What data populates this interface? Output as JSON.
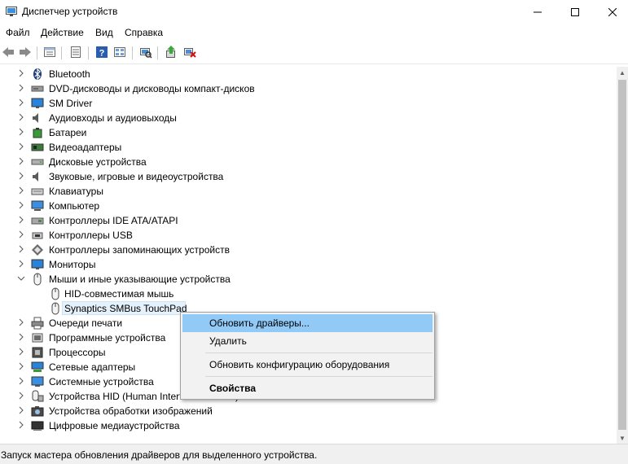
{
  "window": {
    "title": "Диспетчер устройств",
    "minimize": "—",
    "maximize": "☐",
    "close": "✕"
  },
  "menu": [
    "Файл",
    "Действие",
    "Вид",
    "Справка"
  ],
  "toolbar": [
    "back-arrow-icon",
    "forward-arrow-icon",
    "properties-icon",
    "list-view-icon",
    "help-icon",
    "resources-view-icon",
    "scan-hardware-icon",
    "update-driver-icon",
    "uninstall-device-icon"
  ],
  "tree": {
    "categories": [
      {
        "label": "Bluetooth",
        "icon": "bluetooth-icon",
        "expanded": false
      },
      {
        "label": "DVD-дисководы и дисководы компакт-дисков",
        "icon": "dvd-drive-icon",
        "expanded": false
      },
      {
        "label": "SM Driver",
        "icon": "monitor-icon",
        "expanded": false
      },
      {
        "label": "Аудиовходы и аудиовыходы",
        "icon": "speaker-icon",
        "expanded": false
      },
      {
        "label": "Батареи",
        "icon": "battery-icon",
        "expanded": false
      },
      {
        "label": "Видеоадаптеры",
        "icon": "display-adapter-icon",
        "expanded": false
      },
      {
        "label": "Дисковые устройства",
        "icon": "disk-drive-icon",
        "expanded": false
      },
      {
        "label": "Звуковые, игровые и видеоустройства",
        "icon": "speaker-icon",
        "expanded": false
      },
      {
        "label": "Клавиатуры",
        "icon": "keyboard-icon",
        "expanded": false
      },
      {
        "label": "Компьютер",
        "icon": "computer-icon",
        "expanded": false
      },
      {
        "label": "Контроллеры IDE ATA/ATAPI",
        "icon": "ide-controller-icon",
        "expanded": false
      },
      {
        "label": "Контроллеры USB",
        "icon": "usb-icon",
        "expanded": false
      },
      {
        "label": "Контроллеры запоминающих устройств",
        "icon": "storage-controller-icon",
        "expanded": false
      },
      {
        "label": "Мониторы",
        "icon": "monitor-icon",
        "expanded": false
      },
      {
        "label": "Мыши и иные указывающие устройства",
        "icon": "mouse-icon",
        "expanded": true
      }
    ],
    "mouse_children": [
      {
        "label": "HID-совместимая мышь",
        "icon": "mouse-icon"
      },
      {
        "label": "Synaptics SMBus TouchPad",
        "icon": "mouse-icon",
        "selected": true
      }
    ],
    "categories_after": [
      {
        "label": "Очереди печати",
        "icon": "printer-icon"
      },
      {
        "label": "Программные устройства",
        "icon": "software-device-icon"
      },
      {
        "label": "Процессоры",
        "icon": "processor-icon"
      },
      {
        "label": "Сетевые адаптеры",
        "icon": "network-adapter-icon"
      },
      {
        "label": "Системные устройства",
        "icon": "system-device-icon"
      },
      {
        "label": "Устройства HID (Human Interface Devices)",
        "icon": "hid-icon"
      },
      {
        "label": "Устройства обработки изображений",
        "icon": "camera-icon"
      },
      {
        "label": "Цифровые медиаустройства",
        "icon": "media-device-icon"
      }
    ]
  },
  "context_menu": {
    "update_drivers": "Обновить драйверы...",
    "uninstall": "Удалить",
    "scan_hardware": "Обновить конфигурацию оборудования",
    "properties": "Свойства"
  },
  "status": "Запуск мастера обновления драйверов для выделенного устройства.",
  "colors": {
    "selection": "#e5f1fb",
    "menu_highlight": "#91c9f7",
    "accent": "#0078d7"
  }
}
